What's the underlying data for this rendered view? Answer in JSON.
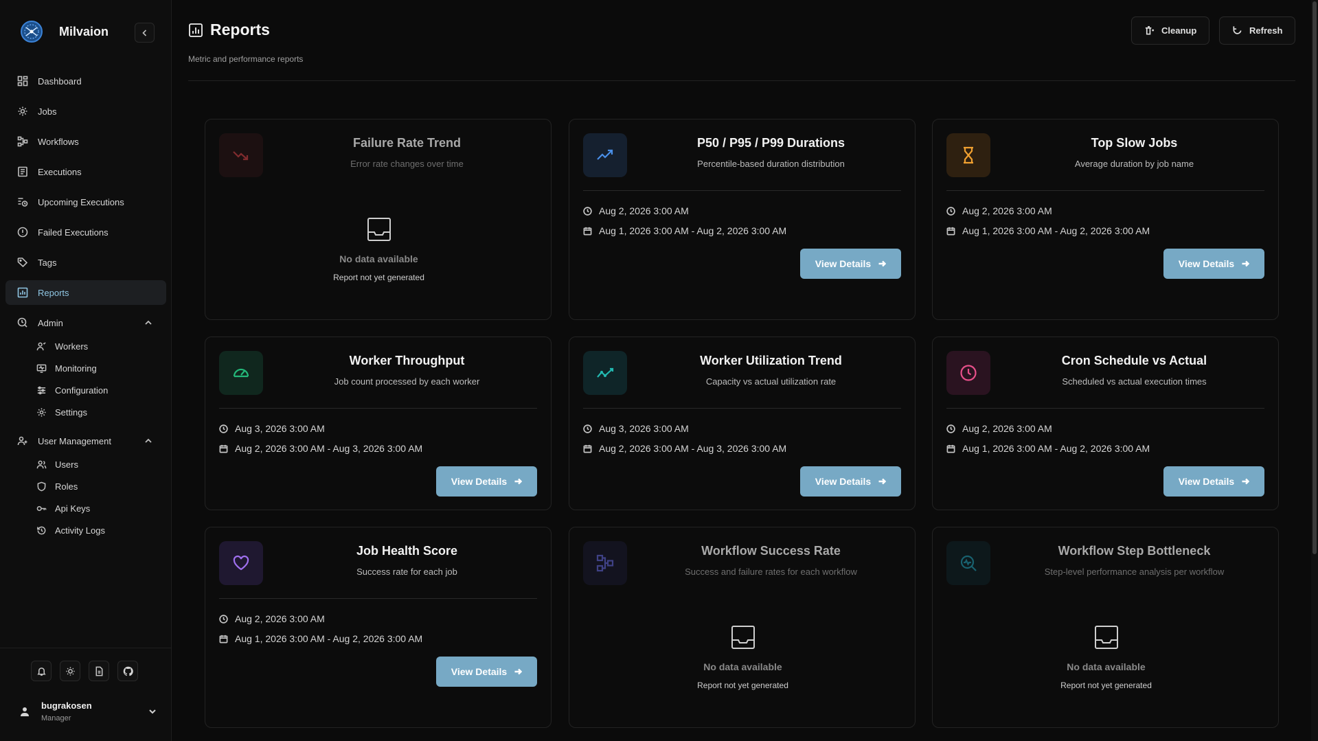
{
  "app": {
    "name": "Milvaion"
  },
  "sidebar": {
    "items": [
      {
        "label": "Dashboard",
        "icon": "dashboard-icon"
      },
      {
        "label": "Jobs",
        "icon": "gear-icon"
      },
      {
        "label": "Workflows",
        "icon": "workflow-icon"
      },
      {
        "label": "Executions",
        "icon": "list-icon"
      },
      {
        "label": "Upcoming Executions",
        "icon": "clock-list-icon"
      },
      {
        "label": "Failed Executions",
        "icon": "alert-circle-icon"
      },
      {
        "label": "Tags",
        "icon": "tag-icon"
      },
      {
        "label": "Reports",
        "icon": "chart-icon",
        "active": true
      }
    ],
    "admin": {
      "label": "Admin",
      "items": [
        {
          "label": "Workers"
        },
        {
          "label": "Monitoring"
        },
        {
          "label": "Configuration"
        },
        {
          "label": "Settings"
        }
      ]
    },
    "user_management": {
      "label": "User Management",
      "items": [
        {
          "label": "Users"
        },
        {
          "label": "Roles"
        },
        {
          "label": "Api Keys"
        },
        {
          "label": "Activity Logs"
        }
      ]
    },
    "user": {
      "name": "bugrakosen",
      "role": "Manager"
    }
  },
  "header": {
    "title": "Reports",
    "subtitle": "Metric and performance reports",
    "cleanup_label": "Cleanup",
    "refresh_label": "Refresh"
  },
  "view_label": "View Details",
  "empty": {
    "title": "No data available",
    "subtitle": "Report not yet generated"
  },
  "cards": [
    {
      "title": "Failure Rate Trend",
      "desc": "Error rate changes over time",
      "icon": "trending-down-icon",
      "color": "#e0464a",
      "bg": "#2a1416",
      "empty": true
    },
    {
      "title": "P50 / P95 / P99 Durations",
      "desc": "Percentile-based duration distribution",
      "icon": "trending-up-icon",
      "color": "#4a8fe8",
      "bg": "#15202f",
      "generated": "Aug 2, 2026 3:00 AM",
      "range": "Aug 1, 2026 3:00 AM - Aug 2, 2026 3:00 AM"
    },
    {
      "title": "Top Slow Jobs",
      "desc": "Average duration by job name",
      "icon": "hourglass-icon",
      "color": "#f0a030",
      "bg": "#2e2010",
      "generated": "Aug 2, 2026 3:00 AM",
      "range": "Aug 1, 2026 3:00 AM - Aug 2, 2026 3:00 AM"
    },
    {
      "title": "Worker Throughput",
      "desc": "Job count processed by each worker",
      "icon": "gauge-icon",
      "color": "#24b87a",
      "bg": "#10271e",
      "generated": "Aug 3, 2026 3:00 AM",
      "range": "Aug 2, 2026 3:00 AM - Aug 3, 2026 3:00 AM"
    },
    {
      "title": "Worker Utilization Trend",
      "desc": "Capacity vs actual utilization rate",
      "icon": "activity-icon",
      "color": "#22b8b0",
      "bg": "#0f2528",
      "generated": "Aug 3, 2026 3:00 AM",
      "range": "Aug 2, 2026 3:00 AM - Aug 3, 2026 3:00 AM"
    },
    {
      "title": "Cron Schedule vs Actual",
      "desc": "Scheduled vs actual execution times",
      "icon": "clock-icon",
      "color": "#e8508a",
      "bg": "#2a1320",
      "generated": "Aug 2, 2026 3:00 AM",
      "range": "Aug 1, 2026 3:00 AM - Aug 2, 2026 3:00 AM"
    },
    {
      "title": "Job Health Score",
      "desc": "Success rate for each job",
      "icon": "heart-icon",
      "color": "#a070f0",
      "bg": "#1f1830",
      "generated": "Aug 2, 2026 3:00 AM",
      "range": "Aug 1, 2026 3:00 AM - Aug 2, 2026 3:00 AM"
    },
    {
      "title": "Workflow Success Rate",
      "desc": "Success and failure rates for each workflow",
      "icon": "workflow-icon",
      "color": "#6a6ee8",
      "bg": "#1a1a30",
      "empty": true
    },
    {
      "title": "Workflow Step Bottleneck",
      "desc": "Step-level performance analysis per workflow",
      "icon": "search-activity-icon",
      "color": "#22a8c0",
      "bg": "#0f2228",
      "empty": true
    }
  ]
}
